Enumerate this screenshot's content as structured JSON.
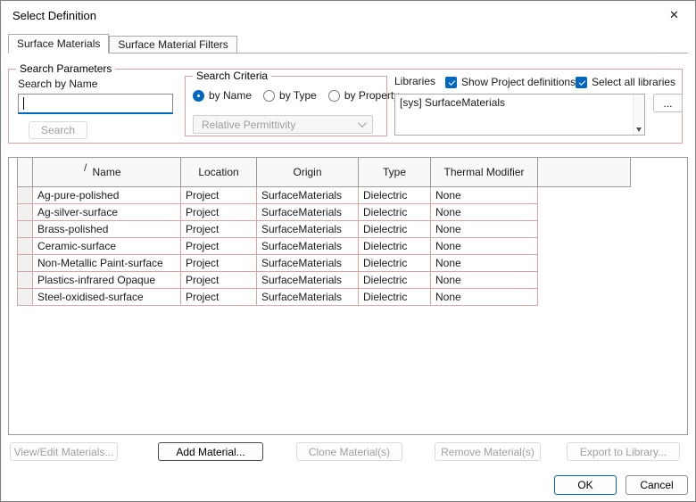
{
  "colors": {
    "accent": "#0067c0",
    "group_border": "#d6a3a3",
    "grid_border": "#d2a7a4",
    "header_border": "#9b9b9b"
  },
  "dialog": {
    "title": "Select Definition",
    "close_icon": "✕"
  },
  "tabs": [
    {
      "label": "Surface Materials",
      "active": true
    },
    {
      "label": "Surface Material Filters",
      "active": false
    }
  ],
  "search": {
    "group_label": "Search Parameters",
    "name_label": "Search by Name",
    "input_value": "",
    "search_button": "Search",
    "search_button_enabled": false,
    "criteria": {
      "group_label": "Search Criteria",
      "options": [
        {
          "label": "by Name",
          "selected": true
        },
        {
          "label": "by Type",
          "selected": false
        },
        {
          "label": "by Property",
          "selected": false
        }
      ],
      "property_dropdown": "Relative Permittivity",
      "property_dropdown_enabled": false
    }
  },
  "libraries": {
    "label": "Libraries",
    "show_project_label": "Show Project definitions",
    "show_project_checked": true,
    "select_all_label": "Select all libraries",
    "select_all_checked": true,
    "items": [
      "[sys] SurfaceMaterials"
    ],
    "browse_button": "..."
  },
  "table": {
    "sort_indicator": "/",
    "columns": [
      "",
      "Name",
      "Location",
      "Origin",
      "Type",
      "Thermal Modifier"
    ],
    "rows": [
      [
        "Ag-pure-polished",
        "Project",
        "SurfaceMaterials",
        "Dielectric",
        "None"
      ],
      [
        "Ag-silver-surface",
        "Project",
        "SurfaceMaterials",
        "Dielectric",
        "None"
      ],
      [
        "Brass-polished",
        "Project",
        "SurfaceMaterials",
        "Dielectric",
        "None"
      ],
      [
        "Ceramic-surface",
        "Project",
        "SurfaceMaterials",
        "Dielectric",
        "None"
      ],
      [
        "Non-Metallic Paint-surface",
        "Project",
        "SurfaceMaterials",
        "Dielectric",
        "None"
      ],
      [
        "Plastics-infrared Opaque",
        "Project",
        "SurfaceMaterials",
        "Dielectric",
        "None"
      ],
      [
        "Steel-oxidised-surface",
        "Project",
        "SurfaceMaterials",
        "Dielectric",
        "None"
      ]
    ]
  },
  "actions": [
    {
      "label": "View/Edit Materials...",
      "enabled": false
    },
    {
      "label": "Add Material...",
      "enabled": true
    },
    {
      "label": "Clone Material(s)",
      "enabled": false
    },
    {
      "label": "Remove Material(s)",
      "enabled": false
    },
    {
      "label": "Export to Library...",
      "enabled": false
    }
  ],
  "footer": {
    "ok_label": "OK",
    "cancel_label": "Cancel"
  }
}
